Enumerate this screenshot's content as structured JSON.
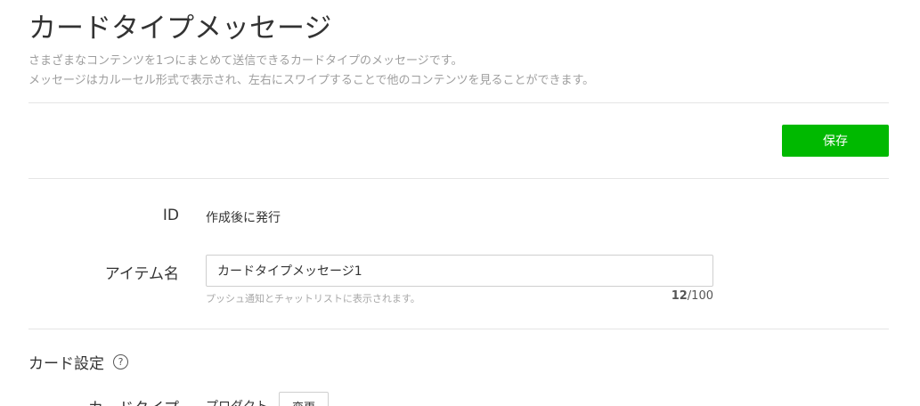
{
  "header": {
    "title": "カードタイプメッセージ",
    "description_line1": "さまざまなコンテンツを1つにまとめて送信できるカードタイプのメッセージです。",
    "description_line2": "メッセージはカルーセル形式で表示され、左右にスワイプすることで他のコンテンツを見ることができます。"
  },
  "toolbar": {
    "save_label": "保存"
  },
  "form": {
    "id_label": "ID",
    "id_value": "作成後に発行",
    "item_name_label": "アイテム名",
    "item_name_value": "カードタイプメッセージ1",
    "item_name_hint": "プッシュ通知とチャットリストに表示されます。",
    "char_count_current": "12",
    "char_count_max": "/100"
  },
  "card_settings": {
    "section_title": "カード設定",
    "help_icon": "?",
    "card_type_label": "カードタイプ",
    "card_type_value": "プロダクト",
    "change_label": "変更"
  },
  "colors": {
    "accent": "#00b900",
    "hint_text": "#a8a8a8",
    "divider": "#e5e5e5"
  }
}
